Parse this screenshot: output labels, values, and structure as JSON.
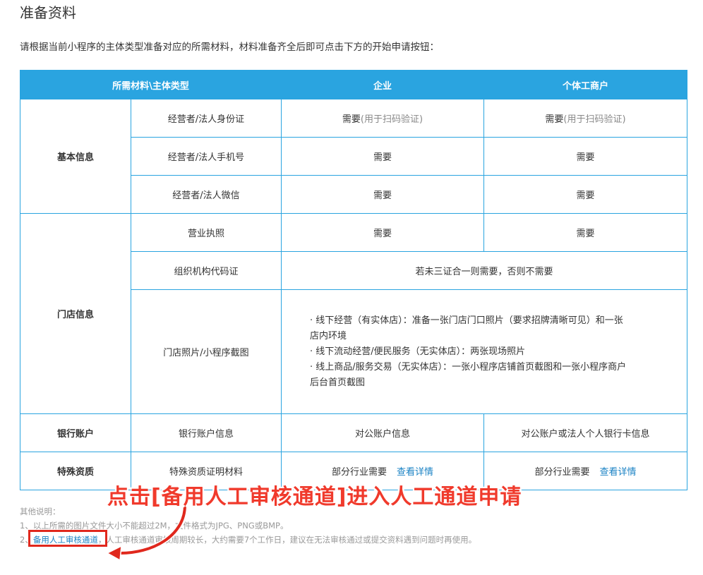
{
  "page": {
    "title": "准备资料",
    "intro": "请根据当前小程序的主体类型准备对应的所需材料，材料准备齐全后即可点击下方的开始申请按钮："
  },
  "table": {
    "headers": [
      "所需材料\\主体类型",
      "企业",
      "个体工商户"
    ],
    "categories": {
      "basic": "基本信息",
      "store": "门店信息",
      "bank": "银行账户",
      "special": "特殊资质"
    },
    "rows": {
      "id_card": {
        "item": "经营者/法人身份证",
        "enterprise_main": "需要",
        "enterprise_note": "(用于扫码验证)",
        "individual_main": "需要",
        "individual_note": "(用于扫码验证)"
      },
      "phone": {
        "item": "经营者/法人手机号",
        "enterprise": "需要",
        "individual": "需要"
      },
      "wechat": {
        "item": "经营者/法人微信",
        "enterprise": "需要",
        "individual": "需要"
      },
      "license": {
        "item": "营业执照",
        "enterprise": "需要",
        "individual": "需要"
      },
      "org_code": {
        "item": "组织机构代码证",
        "merged": "若未三证合一则需要，否则不需要"
      },
      "store_photo": {
        "item": "门店照片/小程序截图",
        "lines": [
          "· 线下经营（有实体店）：准备一张门店门口照片（要求招牌清晰可见）和一张",
          "店内环境",
          "· 线下流动经营/便民服务（无实体店）：两张现场照片",
          "· 线上商品/服务交易（无实体店）：一张小程序店铺首页截图和一张小程序商户",
          "后台首页截图"
        ]
      },
      "bank_info": {
        "item": "银行账户信息",
        "enterprise": "对公账户信息",
        "individual": "对公账户或法人个人银行卡信息"
      },
      "special_cert": {
        "item": "特殊资质证明材料",
        "enterprise": "部分行业需要",
        "individual": "部分行业需要",
        "link": "查看详情"
      }
    }
  },
  "notes": {
    "heading": "其他说明：",
    "line1": "1、以上所需的图片文件大小不能超过2M，文件格式为JPG、PNG或BMP。",
    "line2_prefix": "2、",
    "line2_link": "备用人工审核通道",
    "line2_suffix": "，人工审核通道审核周期较长，大约需要7个工作日，建议在无法审核通过或提交资料遇到问题时再使用。"
  },
  "annotation": {
    "text": "点击[备用人工审核通道]进入人工通道申请",
    "color": "#f03a2c"
  },
  "colors": {
    "header_bg": "#2aa4e0",
    "link": "#1a82c4",
    "highlight_box": "#e0281d"
  }
}
